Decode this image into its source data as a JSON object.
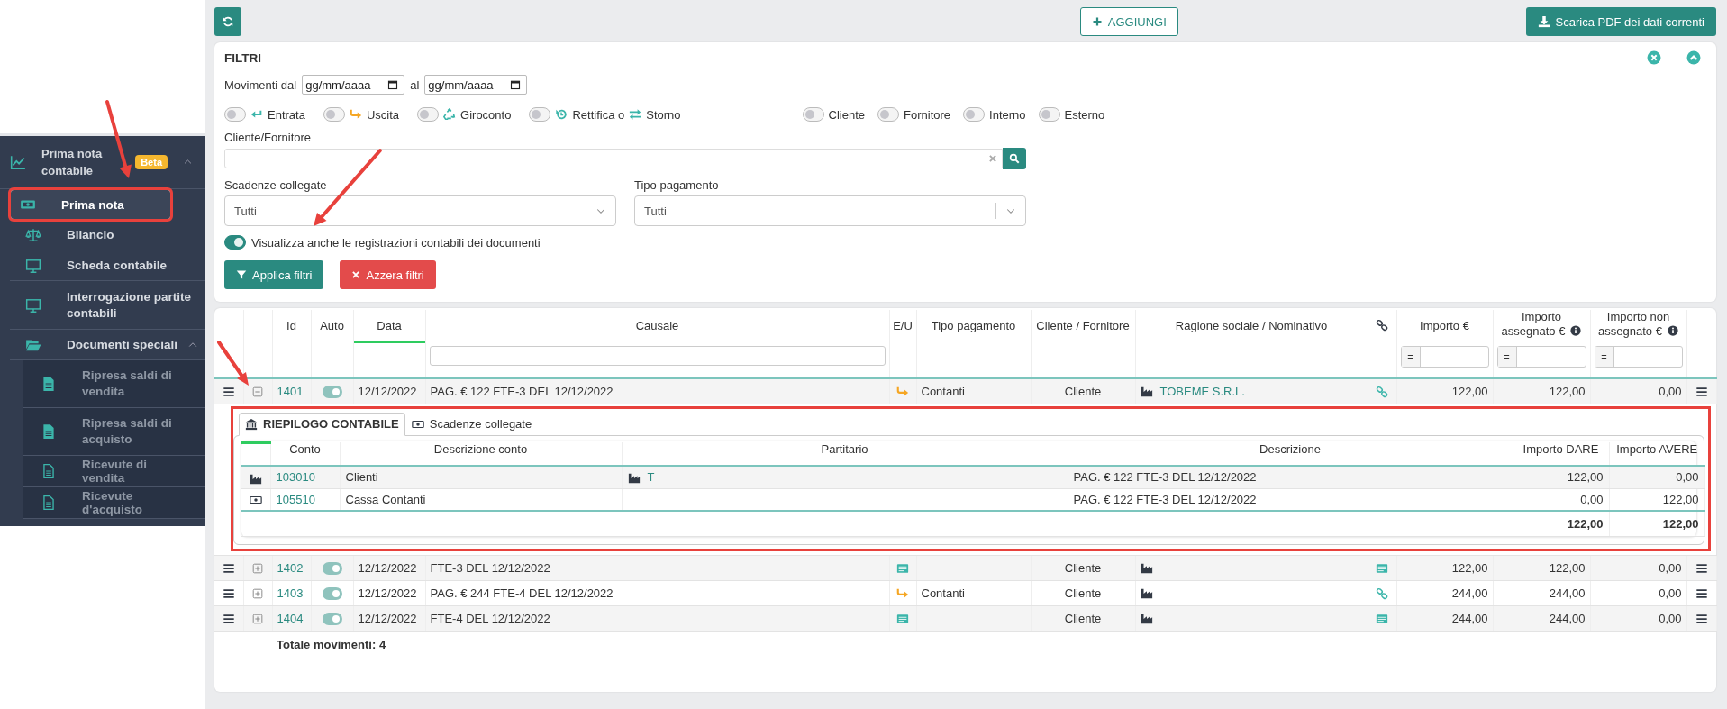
{
  "sidebar": {
    "title": "Prima nota contabile",
    "badge": "Beta",
    "expanded": true,
    "items": [
      {
        "label": "Prima nota",
        "selected": true,
        "highlighted": true
      },
      {
        "label": "Bilancio",
        "selected": false,
        "highlighted": false
      },
      {
        "label": "Scheda contabile",
        "selected": false,
        "highlighted": false
      },
      {
        "label": "Interrogazione partite contabili",
        "selected": false,
        "highlighted": false
      },
      {
        "label": "Documenti speciali",
        "selected": false,
        "highlighted": false,
        "expanded": true,
        "children": [
          {
            "label": "Ripresa saldi di vendita"
          },
          {
            "label": "Ripresa saldi di acquisto"
          },
          {
            "label": "Ricevute di vendita"
          },
          {
            "label": "Ricevute d'acquisto"
          }
        ]
      }
    ]
  },
  "toolbar": {
    "add_button": "AGGIUNGI",
    "download_button": "Scarica PDF dei dati correnti"
  },
  "filters": {
    "title": "FILTRI",
    "date_label": "Movimenti dal",
    "date_from": {
      "placeholder": "gg/mm/aaaa"
    },
    "date_to_label": "al",
    "date_to": {
      "placeholder": "gg/mm/aaaa"
    },
    "movement_toggles": [
      {
        "label": "Entrata",
        "on": false
      },
      {
        "label": "Uscita",
        "on": false
      },
      {
        "label": "Giroconto",
        "on": false
      },
      {
        "label": "Rettifica o",
        "label_2": "Storno",
        "on": false
      }
    ],
    "party_toggles": [
      {
        "label": "Cliente",
        "on": false
      },
      {
        "label": "Fornitore",
        "on": false
      },
      {
        "label": "Interno",
        "on": false
      },
      {
        "label": "Esterno",
        "on": false
      }
    ],
    "party_label": "Cliente/Fornitore",
    "scadenze_label": "Scadenze collegate",
    "scadenze_value": "Tutti",
    "pagamento_label": "Tipo pagamento",
    "pagamento_value": "Tutti",
    "show_documents": {
      "label": "Visualizza anche le registrazioni contabili dei documenti",
      "on": true
    },
    "apply_button": "Applica filtri",
    "reset_button": "Azzera filtri"
  },
  "table": {
    "columns": [
      {
        "sorted": false
      },
      {
        "sorted": false
      },
      {
        "label": "Id",
        "sorted": false
      },
      {
        "label": "Auto",
        "sorted": false
      },
      {
        "label": "Data",
        "sorted": true
      },
      {
        "label": "Causale",
        "sorted": false,
        "kind": "text-filter"
      },
      {
        "label": "E/U",
        "sorted": false
      },
      {
        "label": "Tipo pagamento",
        "sorted": false
      },
      {
        "label": "Cliente / Fornitore",
        "sorted": false
      },
      {
        "label": "Ragione sociale / Nominativo",
        "sorted": false
      },
      {
        "sorted": false,
        "kind": "link"
      },
      {
        "label": "Importo €",
        "sorted": false,
        "kind": "number-filter",
        "filter_op": "="
      },
      {
        "label": "Importo assegnato €",
        "sorted": false,
        "kind": "number-filter",
        "filter_op": "=",
        "info": true
      },
      {
        "label": "Importo non assegnato €",
        "sorted": false,
        "kind": "number-filter",
        "filter_op": "=",
        "info": true
      },
      {
        "sorted": false
      }
    ],
    "rows": [
      {
        "id": "1401",
        "expanded": true,
        "auto": true,
        "date": "12/12/2022",
        "causale": "PAG. € 122 FTE-3 DEL 12/12/2022",
        "eu": {
          "kind": "uscita"
        },
        "tipo": "Contanti",
        "cf": "Cliente",
        "ragione": "TOBEME S.R.L.",
        "link": {
          "kind": "collegamento"
        },
        "importo": "122,00",
        "assegnato": "122,00",
        "non_assegnato": "0,00"
      },
      {
        "id": "1402",
        "expanded": false,
        "auto": true,
        "date": "12/12/2022",
        "causale": "FTE-3 DEL 12/12/2022",
        "eu": {
          "kind": "documento"
        },
        "cf": "Cliente",
        "link": {
          "kind": "documento"
        },
        "importo": "122,00",
        "assegnato": "122,00",
        "non_assegnato": "0,00"
      },
      {
        "id": "1403",
        "expanded": false,
        "auto": true,
        "date": "12/12/2022",
        "causale": "PAG. € 244 FTE-4 DEL 12/12/2022",
        "eu": {
          "kind": "uscita"
        },
        "tipo": "Contanti",
        "cf": "Cliente",
        "link": {
          "kind": "collegamento"
        },
        "importo": "244,00",
        "assegnato": "244,00",
        "non_assegnato": "0,00"
      },
      {
        "id": "1404",
        "expanded": false,
        "auto": true,
        "date": "12/12/2022",
        "causale": "FTE-4 DEL 12/12/2022",
        "eu": {
          "kind": "documento"
        },
        "cf": "Cliente",
        "link": {
          "kind": "documento"
        },
        "importo": "244,00",
        "assegnato": "244,00",
        "non_assegnato": "0,00"
      }
    ],
    "detail": {
      "highlighted": true,
      "tabs": [
        {
          "label": "RIEPILOGO CONTABILE",
          "selected": true
        },
        {
          "label": "Scadenze collegate",
          "selected": false
        }
      ],
      "columns": [
        "Conto",
        "Descrizione conto",
        "Partitario",
        "Descrizione",
        "Importo DARE",
        "Importo AVERE"
      ],
      "rows": [
        {
          "kind": "cliente",
          "conto": "103010",
          "descrizione_conto": "Clienti",
          "partitario": "T",
          "descrizione": "PAG. € 122 FTE-3 DEL 12/12/2022",
          "dare": "122,00",
          "avere": "0,00"
        },
        {
          "kind": "cassa",
          "conto": "105510",
          "descrizione_conto": "Cassa Contanti",
          "descrizione": "PAG. € 122 FTE-3 DEL 12/12/2022",
          "dare": "0,00",
          "avere": "122,00"
        }
      ],
      "total_dare": "122,00",
      "total_avere": "122,00"
    },
    "footer": "Totale movimenti: 4"
  }
}
